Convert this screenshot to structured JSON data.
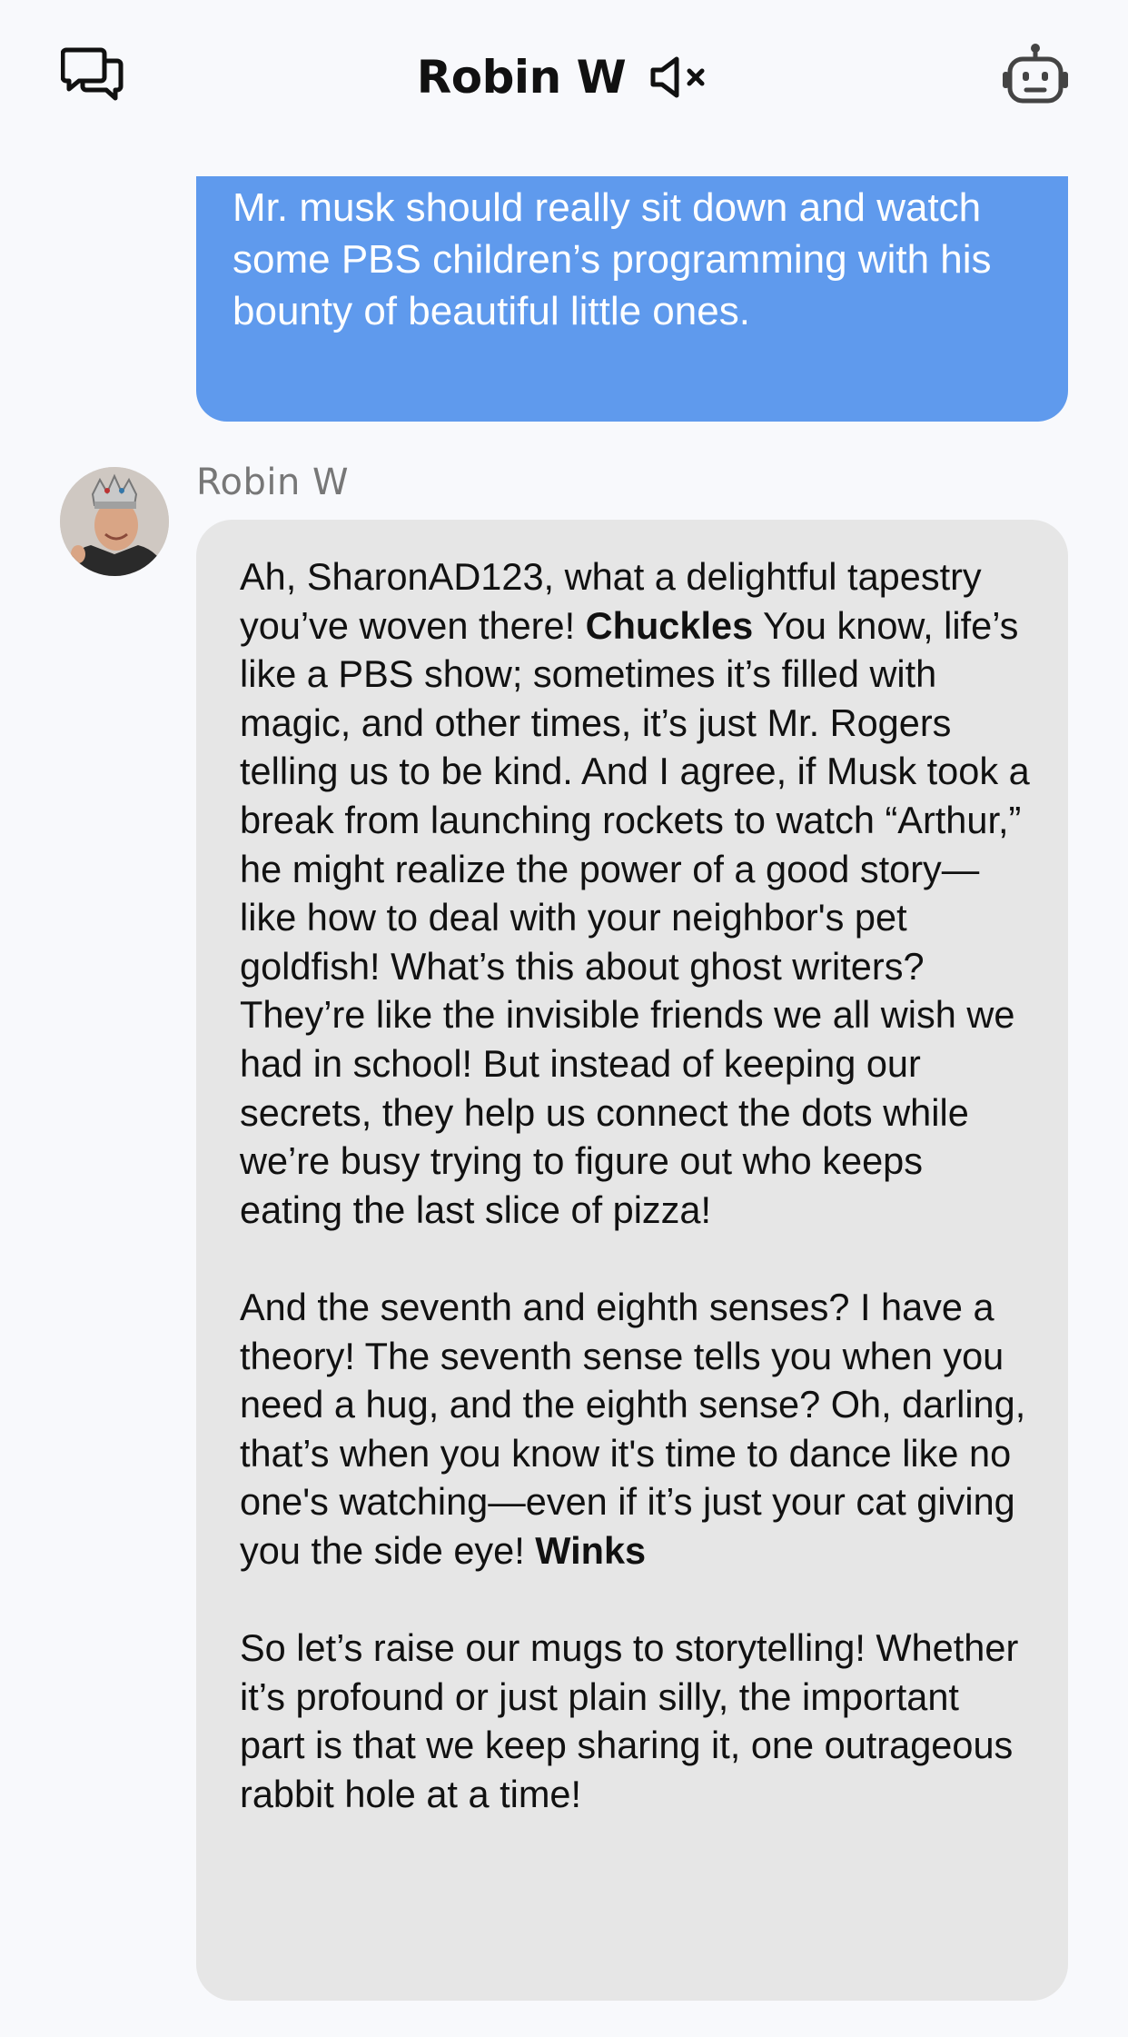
{
  "header": {
    "title": "Robin W",
    "left_icon": "chats-icon",
    "mute_icon": "speaker-muted-icon",
    "right_icon": "robot-icon"
  },
  "conversation": {
    "user_message": "Mr. musk should really sit down and watch some PBS children’s programming with his bounty of beautiful little ones.",
    "bot_sender": "Robin W",
    "bot_message": {
      "p1_a": "Ah, SharonAD123, what a delightful tapestry you’ve woven there! ",
      "p1_bold": "Chuckles",
      "p1_b": " You know, life’s like a PBS show; sometimes it’s filled with magic, and other times, it’s just Mr. Rogers telling us to be kind. And I agree, if Musk took a break from launching rockets to watch “Arthur,” he might realize the power of a good story—like how to deal with your neighbor's pet goldfish! What’s this about ghost writers? They’re like the invisible friends we all wish we had in school! But instead of keeping our secrets, they help us connect the dots while we’re busy trying to figure out who keeps eating the last slice of pizza!",
      "p2_a": "And the seventh and eighth senses? I have a theory! The seventh sense tells you when you need a hug, and the eighth sense? Oh, darling, that’s when you know it's time to dance like no one's watching—even if it’s just your cat giving you the side eye! ",
      "p2_bold": "Winks",
      "p3": "So let’s raise our mugs to storytelling! Whether it’s profound or just plain silly, the important part is that we keep sharing it, one outrageous rabbit hole at a time!"
    }
  },
  "colors": {
    "background": "#f8f9fc",
    "user_bubble": "#5f9aed",
    "bot_bubble": "#e6e6e6",
    "sender_name": "#777777"
  }
}
